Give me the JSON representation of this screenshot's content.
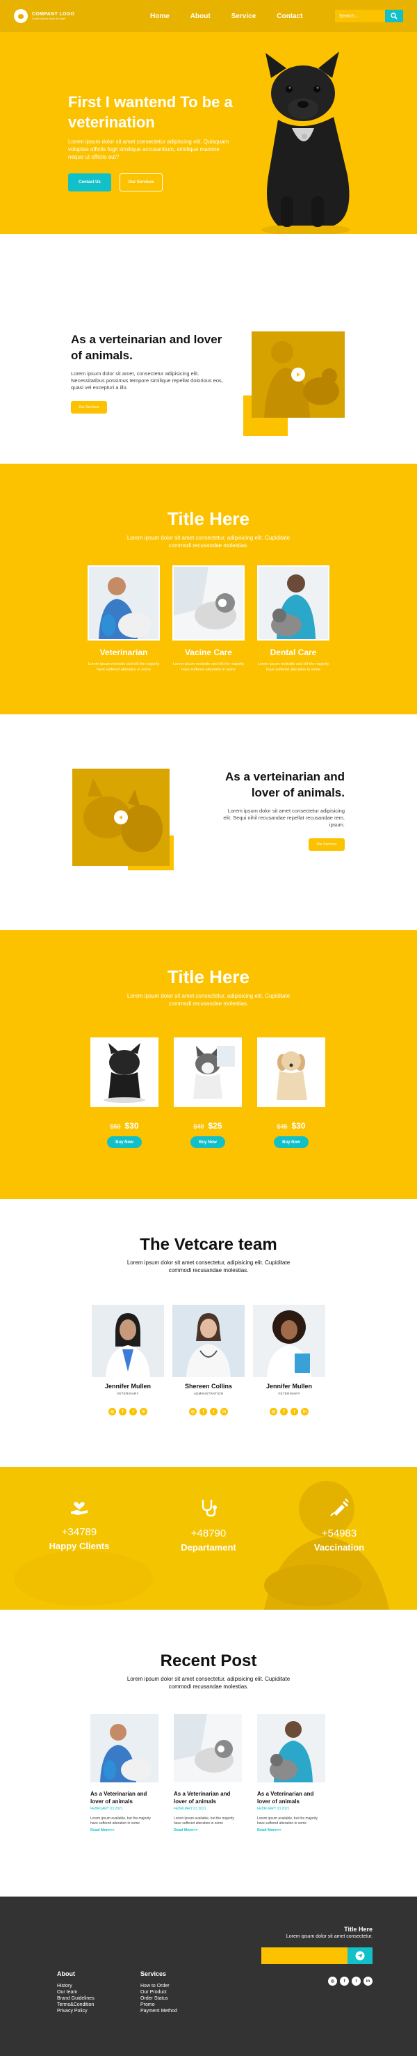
{
  "header": {
    "logo_name": "COMPANY LOGO",
    "logo_tag": "Lorem ipsum dolor sit amet",
    "nav": [
      "Home",
      "About",
      "Service",
      "Contact"
    ],
    "search_placeholder": "Search...",
    "colors": {
      "header": "#e8b300",
      "accent": "#12c0c9",
      "brand": "#fcc200"
    }
  },
  "hero": {
    "title": "First I wantend To be a veterination",
    "text": "Lorem ipsum dolor sit amet consectetur adipiscing elit. Quisquam voluptas officiis fugit similique accusantium, similique maxime neque ut officiis aut?",
    "btn_primary": "Contact Us",
    "btn_secondary": "Our Services"
  },
  "about1": {
    "title": "As a verteinarian and lover of animals.",
    "text": "Lorem ipsum dolor sit amet, consectetur adipisicing elit. Necessitatibus possimus tempore similique repellat dolorious eos, quasi vel excepturi a illo.",
    "button": "Our Services"
  },
  "services": {
    "title": "Title Here",
    "subtitle": "Lorem ipsum dolor sit amet consectetur, adipisicing elit. Cupiditate commodi recusandae molestias.",
    "items": [
      {
        "name": "Veterinarian",
        "text": "Lorem ipsum molestie sed elit the majority have suffered alteration in some"
      },
      {
        "name": "Vacine Care",
        "text": "Lorem ipsum molestie sed elit the majority have suffered alteration in some"
      },
      {
        "name": "Dental Care",
        "text": "Lorem ipsum molestie sed elit the majority have suffered alteration in some"
      }
    ]
  },
  "about2": {
    "title": "As a verteinarian and lover of animals.",
    "text": "Lorem ipsum dolor sit amet consectetur adipisicing elit. Sequi nihil recusandae repellat recusandae rem, ipsum.",
    "button": "Our Services"
  },
  "pricing": {
    "title": "Title Here",
    "subtitle": "Lorem ipsum dolor sit amet consectetur, adipisicing elit. Cupiditate commodi recusandae molestias.",
    "items": [
      {
        "old": "$50",
        "new": "$30",
        "button": "Buy Now"
      },
      {
        "old": "$40",
        "new": "$25",
        "button": "Buy Now"
      },
      {
        "old": "$45",
        "new": "$30",
        "button": "Buy Now"
      }
    ]
  },
  "team": {
    "title": "The Vetcare team",
    "subtitle": "Lorem ipsum dolor sit amet consectetur, adipisicing elit. Cupiditate commodi recusandae molestias.",
    "members": [
      {
        "name": "Jennifer Mullen",
        "role": "VETERINARY"
      },
      {
        "name": "Shereen Collins",
        "role": "ADMINISTRATION"
      },
      {
        "name": "Jennifer Mullen",
        "role": "VETERINARY"
      }
    ],
    "social_icons": [
      "instagram-icon",
      "facebook-icon",
      "twitter-icon",
      "linkedin-icon"
    ]
  },
  "stats": [
    {
      "num": "+34789",
      "label": "Happy Clients",
      "icon": "hand-heart-icon"
    },
    {
      "num": "+48790",
      "label": "Departament",
      "icon": "stethoscope-icon"
    },
    {
      "num": "+54983",
      "label": "Vaccination",
      "icon": "syringe-icon"
    }
  ],
  "posts": {
    "title": "Recent Post",
    "subtitle": "Lorem ipsum dolor sit amet consectetur, adipisicing elit. Cupiditate commodi recusandae molestias.",
    "items": [
      {
        "title": "As a Veterinarian and lover of animals",
        "date": "FEBRUARY 03 2021",
        "text": "Lorem ipsum available, but the majority have suffered alteration in some",
        "more": "Read More>>"
      },
      {
        "title": "As a Veterinarian and lover of animals",
        "date": "FEBRUARY 03 2021",
        "text": "Lorem ipsum available, but the majority have suffered alteration in some",
        "more": "Read More>>"
      },
      {
        "title": "As a Veterinarian and lover of animals",
        "date": "FEBRUARY 03 2021",
        "text": "Lorem ipsum available, but the majority have suffered alteration in some",
        "more": "Read More>>"
      }
    ]
  },
  "footer": {
    "about_title": "About",
    "about_links": [
      "History",
      "Our team",
      "Brand Guidelines",
      "Terms&Condition",
      "Privacy Policy"
    ],
    "services_title": "Services",
    "services_links": [
      "How to Order",
      "Our Product",
      "Order Status",
      "Promo",
      "Payment Method"
    ],
    "news_title": "Title Here",
    "news_text": "Lorem ipsum dolor sit amet consectetur.",
    "social_icons": [
      "instagram-icon",
      "facebook-icon",
      "twitter-icon",
      "linkedin-icon"
    ]
  }
}
